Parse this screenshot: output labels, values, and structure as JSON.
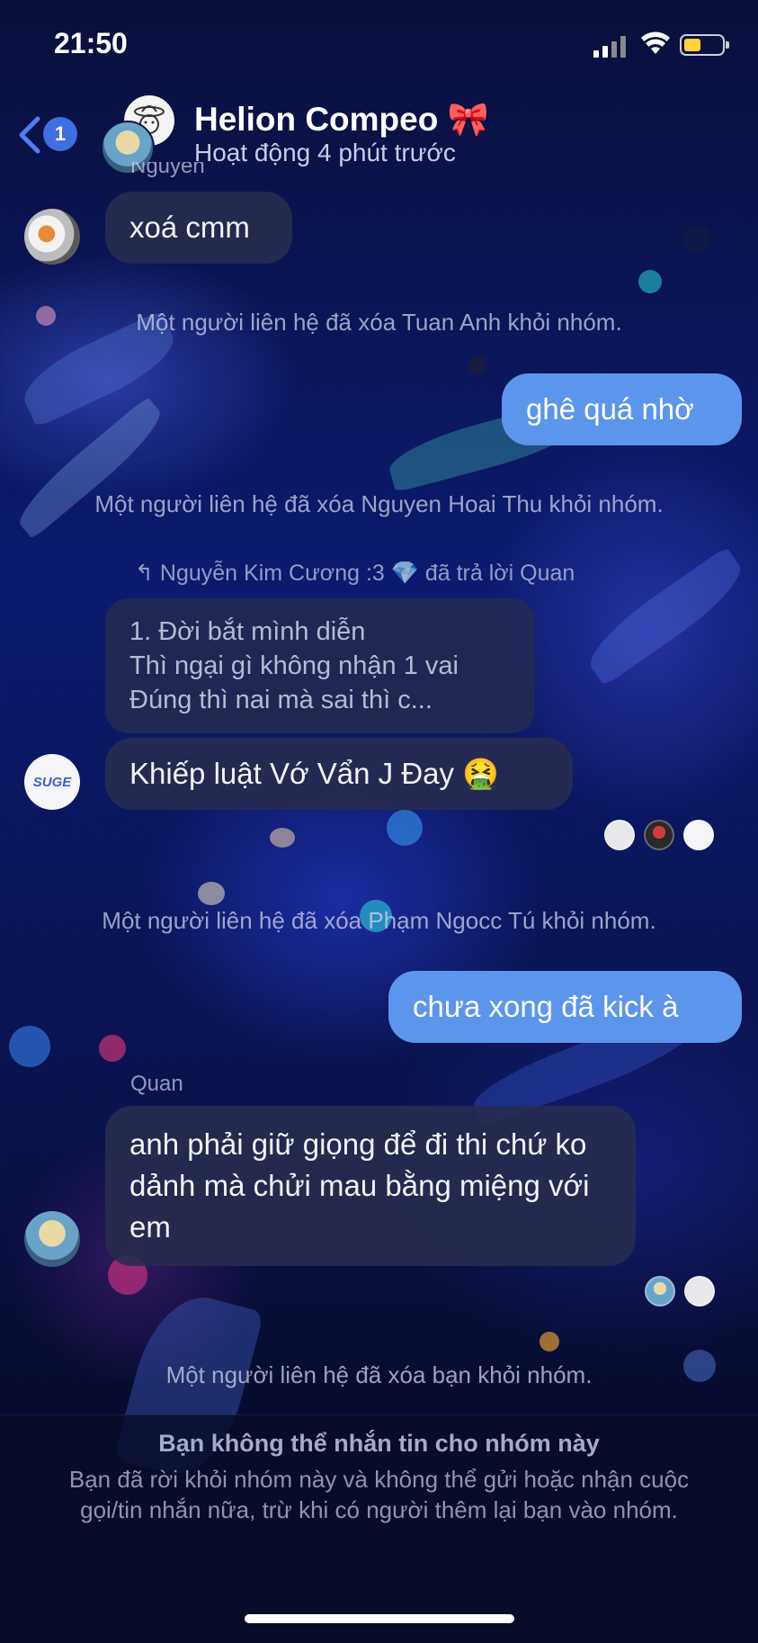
{
  "status_bar": {
    "time": "21:50"
  },
  "header": {
    "back_badge": "1",
    "title": "Helion Compeo 🎀",
    "subtitle": "Hoạt động 4 phút trước"
  },
  "messages": {
    "top_sender_partial": "Nguyen",
    "m1": "xoá cmm",
    "sys1": "Một người liên hệ đã xóa Tuan Anh khỏi nhóm.",
    "m2": "ghê quá nhờ",
    "sys2": "Một người liên hệ đã xóa Nguyen Hoai Thu khỏi nhóm.",
    "reply_note": "Nguyễn Kim Cương :3 💎 đã trả lời Quan",
    "quote_lines": [
      "1. Đời bắt mình diễn",
      "Thì ngại gì không nhận 1 vai",
      "Đúng thì nai mà sai thì c..."
    ],
    "m3": "Khiếp luật Vớ Vẩn J Đay 🤮",
    "sys3": "Một người liên hệ đã xóa Phạm Ngocc Tú khỏi nhóm.",
    "m4": "chưa xong đã kick à",
    "sender_quan": "Quan",
    "m5": "anh phải giữ giọng để đi thi chứ ko dảnh mà chửi mau bằng miệng với em",
    "sys4": "Một người liên hệ đã xóa bạn khỏi nhóm.",
    "avatar_text_suge": "SUGE"
  },
  "footer": {
    "title": "Bạn không thể nhắn tin cho nhóm này",
    "body": "Bạn đã rời khỏi nhóm này và không thể gửi hoặc nhận cuộc gọi/tin nhắn nữa, trừ khi có người thêm lại bạn vào nhóm."
  },
  "colors": {
    "outgoing_bubble": "#5c95ec",
    "incoming_bubble": "#282c4e",
    "badge": "#3f6ee0",
    "battery": "#ffd33d"
  }
}
